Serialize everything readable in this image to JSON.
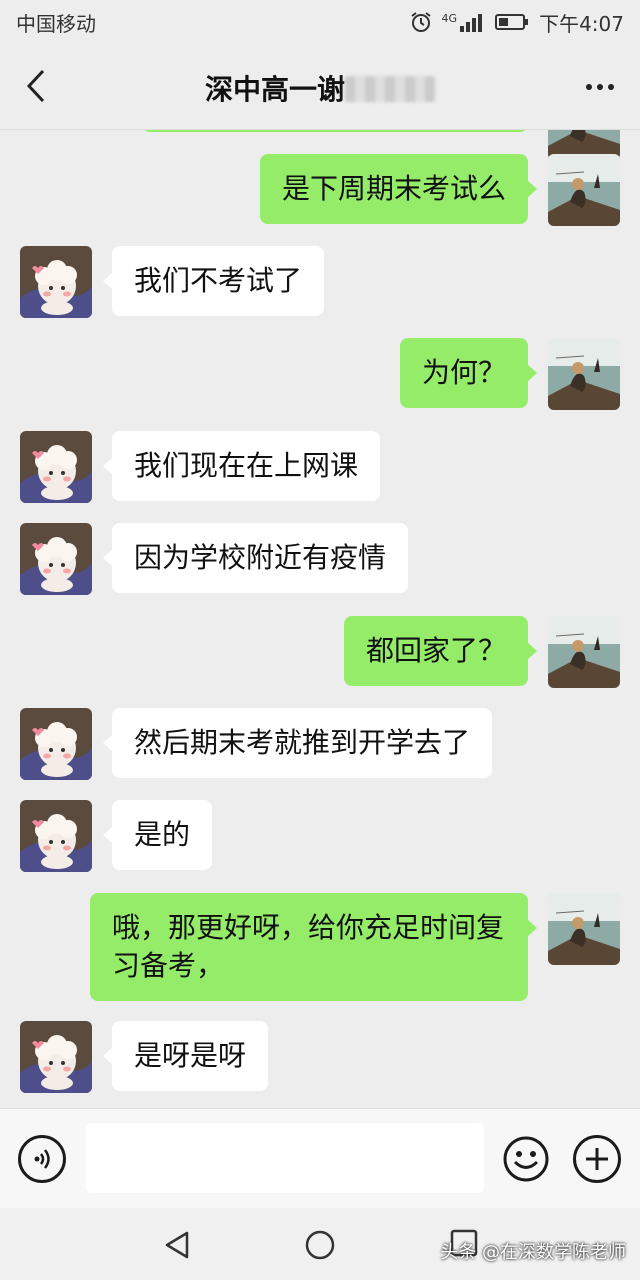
{
  "status_bar": {
    "carrier": "中国移动",
    "network": "4G",
    "time": "下午4:07"
  },
  "header": {
    "title": "深中高一谢"
  },
  "messages": [
    {
      "side": "out",
      "text": "是下周期末考试么"
    },
    {
      "side": "in",
      "text": "我们不考试了"
    },
    {
      "side": "out",
      "text": "为何？"
    },
    {
      "side": "in",
      "text": "我们现在在上网课"
    },
    {
      "side": "in",
      "text": "因为学校附近有疫情"
    },
    {
      "side": "out",
      "text": "都回家了？"
    },
    {
      "side": "in",
      "text": "然后期末考就推到开学去了"
    },
    {
      "side": "in",
      "text": "是的"
    },
    {
      "side": "out",
      "text": "哦，那更好呀，给你充足时间复习备考，"
    },
    {
      "side": "in",
      "text": "是呀是呀"
    }
  ],
  "icons": {
    "back": "chevron-left-icon",
    "more": "more-dots-icon",
    "voice": "voice-icon",
    "emoji": "emoji-icon",
    "plus": "plus-icon"
  },
  "watermark": "头条 @在深数学陈老师",
  "colors": {
    "outgoing_bubble": "#95ec69",
    "incoming_bubble": "#ffffff",
    "background": "#ededed"
  }
}
